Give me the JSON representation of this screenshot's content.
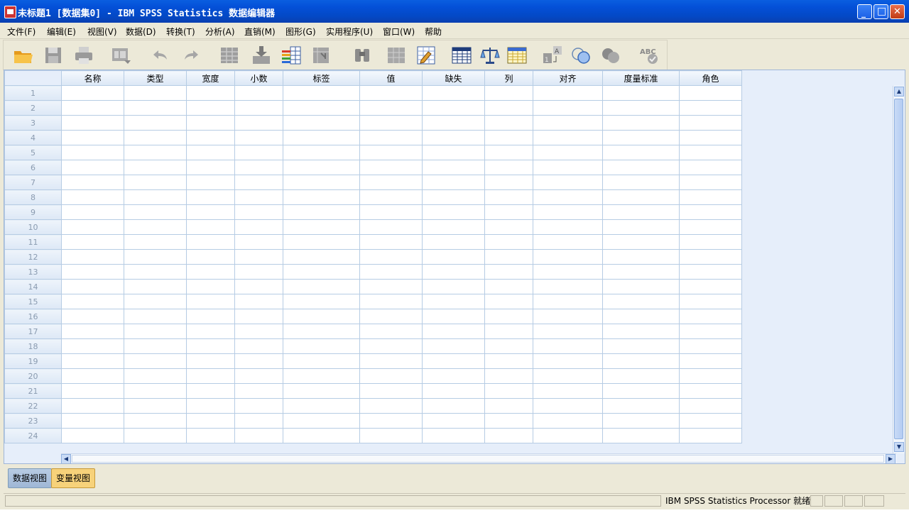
{
  "window": {
    "title": "未标题1 [数据集0] - IBM SPSS Statistics 数据编辑器",
    "controls": {
      "minimize": "_",
      "maximize": "□",
      "close": "✕"
    }
  },
  "menu": [
    "文件(F)",
    "编辑(E)",
    "视图(V)",
    "数据(D)",
    "转换(T)",
    "分析(A)",
    "直销(M)",
    "图形(G)",
    "实用程序(U)",
    "窗口(W)",
    "帮助"
  ],
  "toolbar": {
    "icons": [
      "open-folder-icon",
      "save-icon",
      "print-icon",
      "dialog-recall-icon",
      "undo-icon",
      "redo-icon",
      "goto-case-icon",
      "goto-variable-icon",
      "variables-icon",
      "run-descriptives-icon",
      "find-icon",
      "insert-cases-icon",
      "insert-variable-icon",
      "split-file-icon",
      "weight-cases-icon",
      "select-cases-icon",
      "value-labels-icon",
      "use-variable-sets-icon",
      "show-all-variables-icon",
      "spell-check-icon"
    ]
  },
  "grid": {
    "columns": [
      "名称",
      "类型",
      "宽度",
      "小数",
      "标签",
      "值",
      "缺失",
      "列",
      "对齐",
      "度量标准",
      "角色"
    ],
    "row_numbers": [
      "1",
      "2",
      "3",
      "4",
      "5",
      "6",
      "7",
      "8",
      "9",
      "10",
      "11",
      "12",
      "13",
      "14",
      "15",
      "16",
      "17",
      "18",
      "19",
      "20",
      "21",
      "22",
      "23",
      "24"
    ]
  },
  "tabs": {
    "data_view": "数据视图",
    "variable_view": "变量视图",
    "active": "variable_view"
  },
  "status": {
    "processor": "IBM SPSS Statistics Processor 就绪"
  },
  "colors": {
    "title_bar": "#0450d8",
    "active_tab": "#f7d27a",
    "grid_border": "#b6cce4"
  }
}
